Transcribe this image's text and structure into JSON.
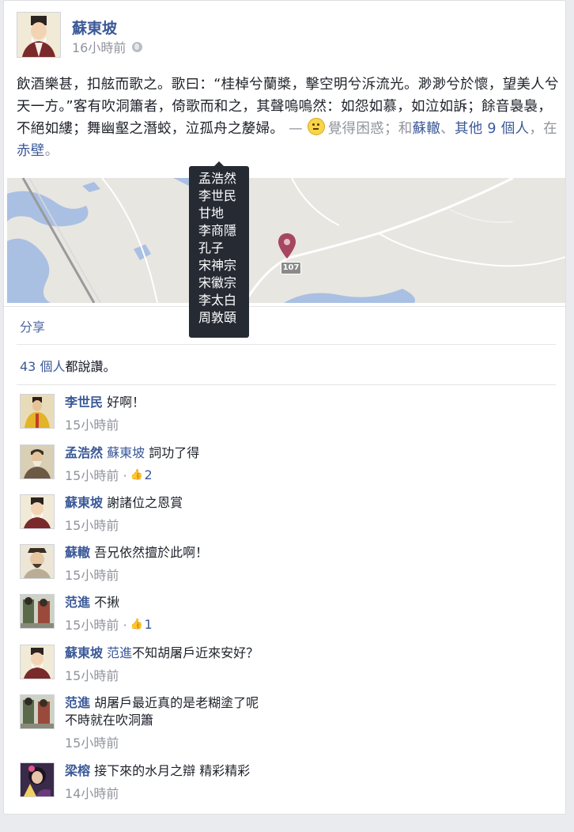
{
  "post": {
    "author": "蘇東坡",
    "time": "16小時前",
    "body_text": "飲酒樂甚，扣舷而歌之。歌曰：“桂棹兮蘭槳，擊空明兮泝流光。渺渺兮於懷，望美人兮天一方。”客有吹洞簫者，倚歌而和之，其聲嗚嗚然：如怨如慕，如泣如訴；餘音裊裊，不絕如縷；舞幽壑之潛蛟，泣孤舟之嫠婦。",
    "feeling_prefix": " — ",
    "feeling": "覺得困惑",
    "with_prefix": "；和",
    "with_person": "蘇轍",
    "sep": "、",
    "others_link": "其他 9 個人",
    "at_prefix": "，在",
    "place": "赤壁",
    "end": "。"
  },
  "map": {
    "route_number": "107",
    "marker_color": "#a6475f",
    "water_color": "#a9c0e3"
  },
  "tooltip_names": [
    "孟浩然",
    "李世民",
    "甘地",
    "李商隱",
    "孔子",
    "宋神宗",
    "宋徽宗",
    "李太白",
    "周敦頤"
  ],
  "actions": {
    "share": "分享"
  },
  "likes": {
    "count": "43 個人",
    "suffix": "都說讚。"
  },
  "comments": [
    {
      "name": "李世民",
      "tag": "",
      "text": "好啊！",
      "time": "15小時前",
      "likes": ""
    },
    {
      "name": "孟浩然",
      "tag": "蘇東坡",
      "text": "詞功了得",
      "time": "15小時前 · ",
      "likes": "2"
    },
    {
      "name": "蘇東坡",
      "tag": "",
      "text": "謝諸位之恩賞",
      "time": "15小時前",
      "likes": ""
    },
    {
      "name": "蘇轍",
      "tag": "",
      "text": "吾兄依然擅於此啊！",
      "time": "15小時前",
      "likes": ""
    },
    {
      "name": "范進",
      "tag": "",
      "text": "不揪",
      "time": "15小時前 · ",
      "likes": "1"
    },
    {
      "name": "蘇東坡",
      "tag": "范進",
      "text": "不知胡屠戶近來安好？",
      "time": "15小時前",
      "likes": ""
    },
    {
      "name": "范進",
      "tag": "",
      "text": "胡屠戶最近真的是老糊塗了呢",
      "text2": "不時就在吹洞簫",
      "time": "15小時前",
      "likes": ""
    },
    {
      "name": "梁榕",
      "tag": "",
      "text": "接下來的水月之辯 精彩精彩",
      "time": "14小時前",
      "likes": ""
    }
  ],
  "colors": {
    "link": "#3b5998",
    "meta": "#90949c",
    "tooltip_bg": "#262a33"
  }
}
